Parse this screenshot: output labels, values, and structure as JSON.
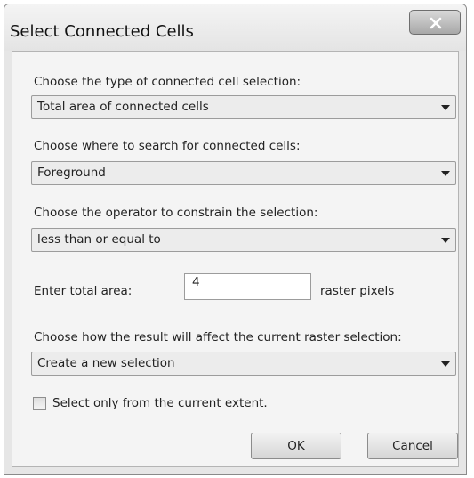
{
  "dialog": {
    "title": "Select Connected Cells",
    "close_icon": "close-x-icon"
  },
  "fields": {
    "selection_type": {
      "label": "Choose the type of connected cell selection:",
      "value": "Total area of connected cells"
    },
    "search_where": {
      "label": "Choose where to search for connected cells:",
      "value": "Foreground"
    },
    "operator": {
      "label": "Choose the operator to constrain the selection:",
      "value": "less than or equal to"
    },
    "total_area": {
      "label": "Enter total area:",
      "value": "4",
      "unit": "raster pixels"
    },
    "result_effect": {
      "label": "Choose how the result will affect the current raster selection:",
      "value": "Create a new selection"
    },
    "current_extent": {
      "label": "Select only from the current extent.",
      "checked": false
    }
  },
  "buttons": {
    "ok": "OK",
    "cancel": "Cancel"
  },
  "colors": {
    "window_bg": "#e6e6e6",
    "client_bg": "#f4f4f4",
    "close_button": "#b5b5b5"
  }
}
